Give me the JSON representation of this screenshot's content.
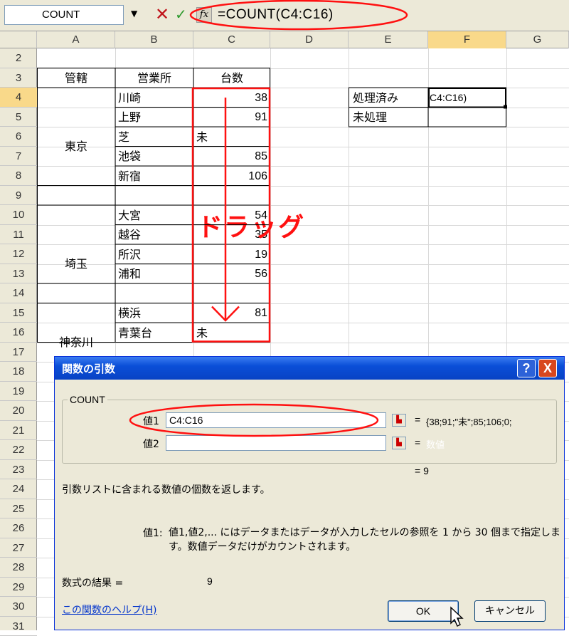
{
  "formula_bar": {
    "name_box": "COUNT",
    "formula": "=COUNT(C4:C16)"
  },
  "columns": [
    "A",
    "B",
    "C",
    "D",
    "E",
    "F",
    "G"
  ],
  "rows": [
    "2",
    "3",
    "4",
    "5",
    "6",
    "7",
    "8",
    "9",
    "10",
    "11",
    "12",
    "13",
    "14",
    "15",
    "16",
    "17",
    "18",
    "19",
    "20",
    "21",
    "22",
    "23",
    "24",
    "25",
    "26",
    "27",
    "28",
    "29",
    "30",
    "31"
  ],
  "table": {
    "headers": {
      "a": "管轄",
      "b": "営業所",
      "c": "台数"
    },
    "groups": {
      "tokyo": "東京",
      "saitama": "埼玉",
      "kanagawa": "神奈川"
    },
    "offices": [
      "川崎",
      "上野",
      "芝",
      "池袋",
      "新宿",
      "",
      "大宮",
      "越谷",
      "所沢",
      "浦和",
      "",
      "横浜",
      "青葉台"
    ],
    "counts": [
      "38",
      "91",
      "未",
      "85",
      "106",
      "",
      "54",
      "35",
      "19",
      "56",
      "",
      "81",
      "未"
    ]
  },
  "side_table": {
    "processed_label": "処理済み",
    "processed_value": "C4:C16)",
    "unprocessed_label": "未処理"
  },
  "annotation": {
    "drag_text": "ドラッグ",
    "accent_color": "#ff1010"
  },
  "dialog": {
    "title": "関数の引数",
    "help_label": "?",
    "close_label": "X",
    "group_label": "COUNT",
    "arg1_label": "値1",
    "arg1_value": "C4:C16",
    "arg1_result": "{38;91;\"未\";85;106;0;",
    "arg2_label": "値2",
    "arg2_value": "",
    "arg2_result": "数値",
    "equals": "=",
    "total_result": "= 9",
    "description": "引数リストに含まれる数値の個数を返します。",
    "arg_desc_key": "値1:",
    "arg_desc": "値1,値2,... にはデータまたはデータが入力したセルの参照を 1 から 30 個まで指定します。数値データだけがカウントされます。",
    "formula_result_label": "数式の結果 =",
    "formula_result_value": "9",
    "help_link": "この関数のヘルプ(H)",
    "ok_label": "OK",
    "cancel_label": "キャンセル"
  },
  "icons": {
    "cancel": "cancel-x-icon",
    "enter": "check-icon",
    "function": "fx-icon",
    "collapse": "collapse-dialog-icon",
    "cursor": "mouse-pointer-icon"
  }
}
